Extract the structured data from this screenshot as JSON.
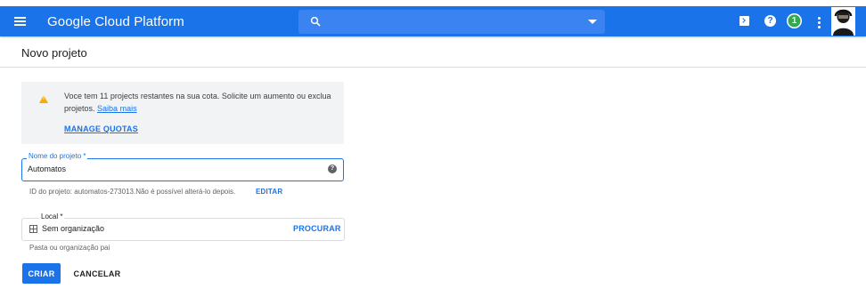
{
  "header": {
    "app_title": "Google Cloud Platform",
    "search_placeholder": "",
    "notification_count": "1",
    "help_glyph": "?",
    "icons": [
      "menu-icon",
      "search-icon",
      "dropdown-caret-icon",
      "cloud-shell-icon",
      "help-icon",
      "notification-icon",
      "more-vert-icon",
      "avatar"
    ]
  },
  "page": {
    "title": "Novo projeto"
  },
  "quota": {
    "message": "Voce tem 11 projects restantes na sua cota. Solicite um aumento ou exclua projetos.",
    "learn_more": "Saiba mais",
    "manage_quotas": "MANAGE QUOTAS"
  },
  "project_name": {
    "label": "Nome do projeto *",
    "value": "Automatos",
    "project_id_text": "ID do projeto: automatos-273013.Não é possível alterá-lo depois.",
    "edit_label": "EDITAR"
  },
  "location": {
    "label": "Local *",
    "value": "Sem organização",
    "browse_label": "PROCURAR",
    "hint": "Pasta ou organização pai"
  },
  "actions": {
    "create_label": "CRIAR",
    "cancel_label": "CANCELAR"
  },
  "colors": {
    "primary": "#1a73e8",
    "warning": "#f9ab00",
    "notification": "#34a853"
  }
}
